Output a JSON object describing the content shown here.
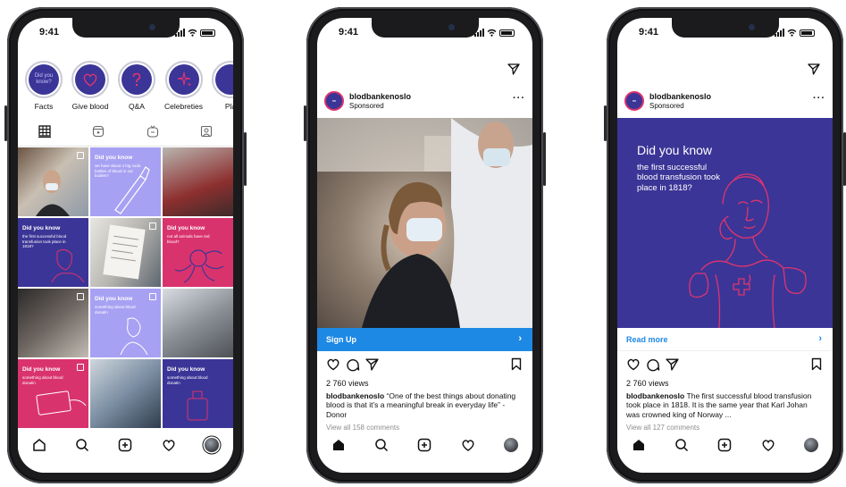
{
  "status": {
    "time": "9:41"
  },
  "phone1": {
    "stories": [
      {
        "label": "Facts",
        "bubble_text": "Did you know?"
      },
      {
        "label": "Give blood",
        "bubble_text": ""
      },
      {
        "label": "Q&A",
        "bubble_text": ""
      },
      {
        "label": "Celebreties",
        "bubble_text": ""
      },
      {
        "label": "Pla",
        "bubble_text": ""
      }
    ],
    "grid": [
      {
        "title": "",
        "text": ""
      },
      {
        "title": "Did you know",
        "text": "we have about 4 big soda bottles of blood in our bodies?"
      },
      {
        "title": "",
        "text": ""
      },
      {
        "title": "Did you know",
        "text": "the first successful blood transfusion took place in 1818?"
      },
      {
        "title": "",
        "text": ""
      },
      {
        "title": "Did you know",
        "text": "not all animals have red blood?"
      },
      {
        "title": "",
        "text": ""
      },
      {
        "title": "Did you know",
        "text": "something about blood donatin"
      },
      {
        "title": "",
        "text": ""
      },
      {
        "title": "Did you know",
        "text": "something about blood donatin"
      },
      {
        "title": "",
        "text": ""
      },
      {
        "title": "Did you know",
        "text": "something about blood donatin"
      }
    ]
  },
  "phone2": {
    "username": "blodbankenoslo",
    "sponsored": "Sponsored",
    "cta": "Sign Up",
    "views": "2 760 views",
    "caption_user": "blodbankenoslo",
    "caption_text": "“One of the best things about donating blood is that it’s a meaningful break in everyday life” - Donor",
    "comments": "View all 158 comments"
  },
  "phone3": {
    "username": "blodbankenoslo",
    "sponsored": "Sponsored",
    "media_title": "Did you know",
    "media_text": "the first successful blood transfusion took place in 1818?",
    "cta": "Read more",
    "views": "2 760 views",
    "caption_user": "blodbankenoslo",
    "caption_text": "The first successful blood transfusion took place in 1818. It is the same year that Karl Johan was crowned king of Norway ...",
    "comments": "View all 127 comments"
  },
  "colors": {
    "navy": "#3b3597",
    "lilac": "#a7a1f3",
    "pink": "#d9336d",
    "link_blue": "#1e88e5"
  }
}
